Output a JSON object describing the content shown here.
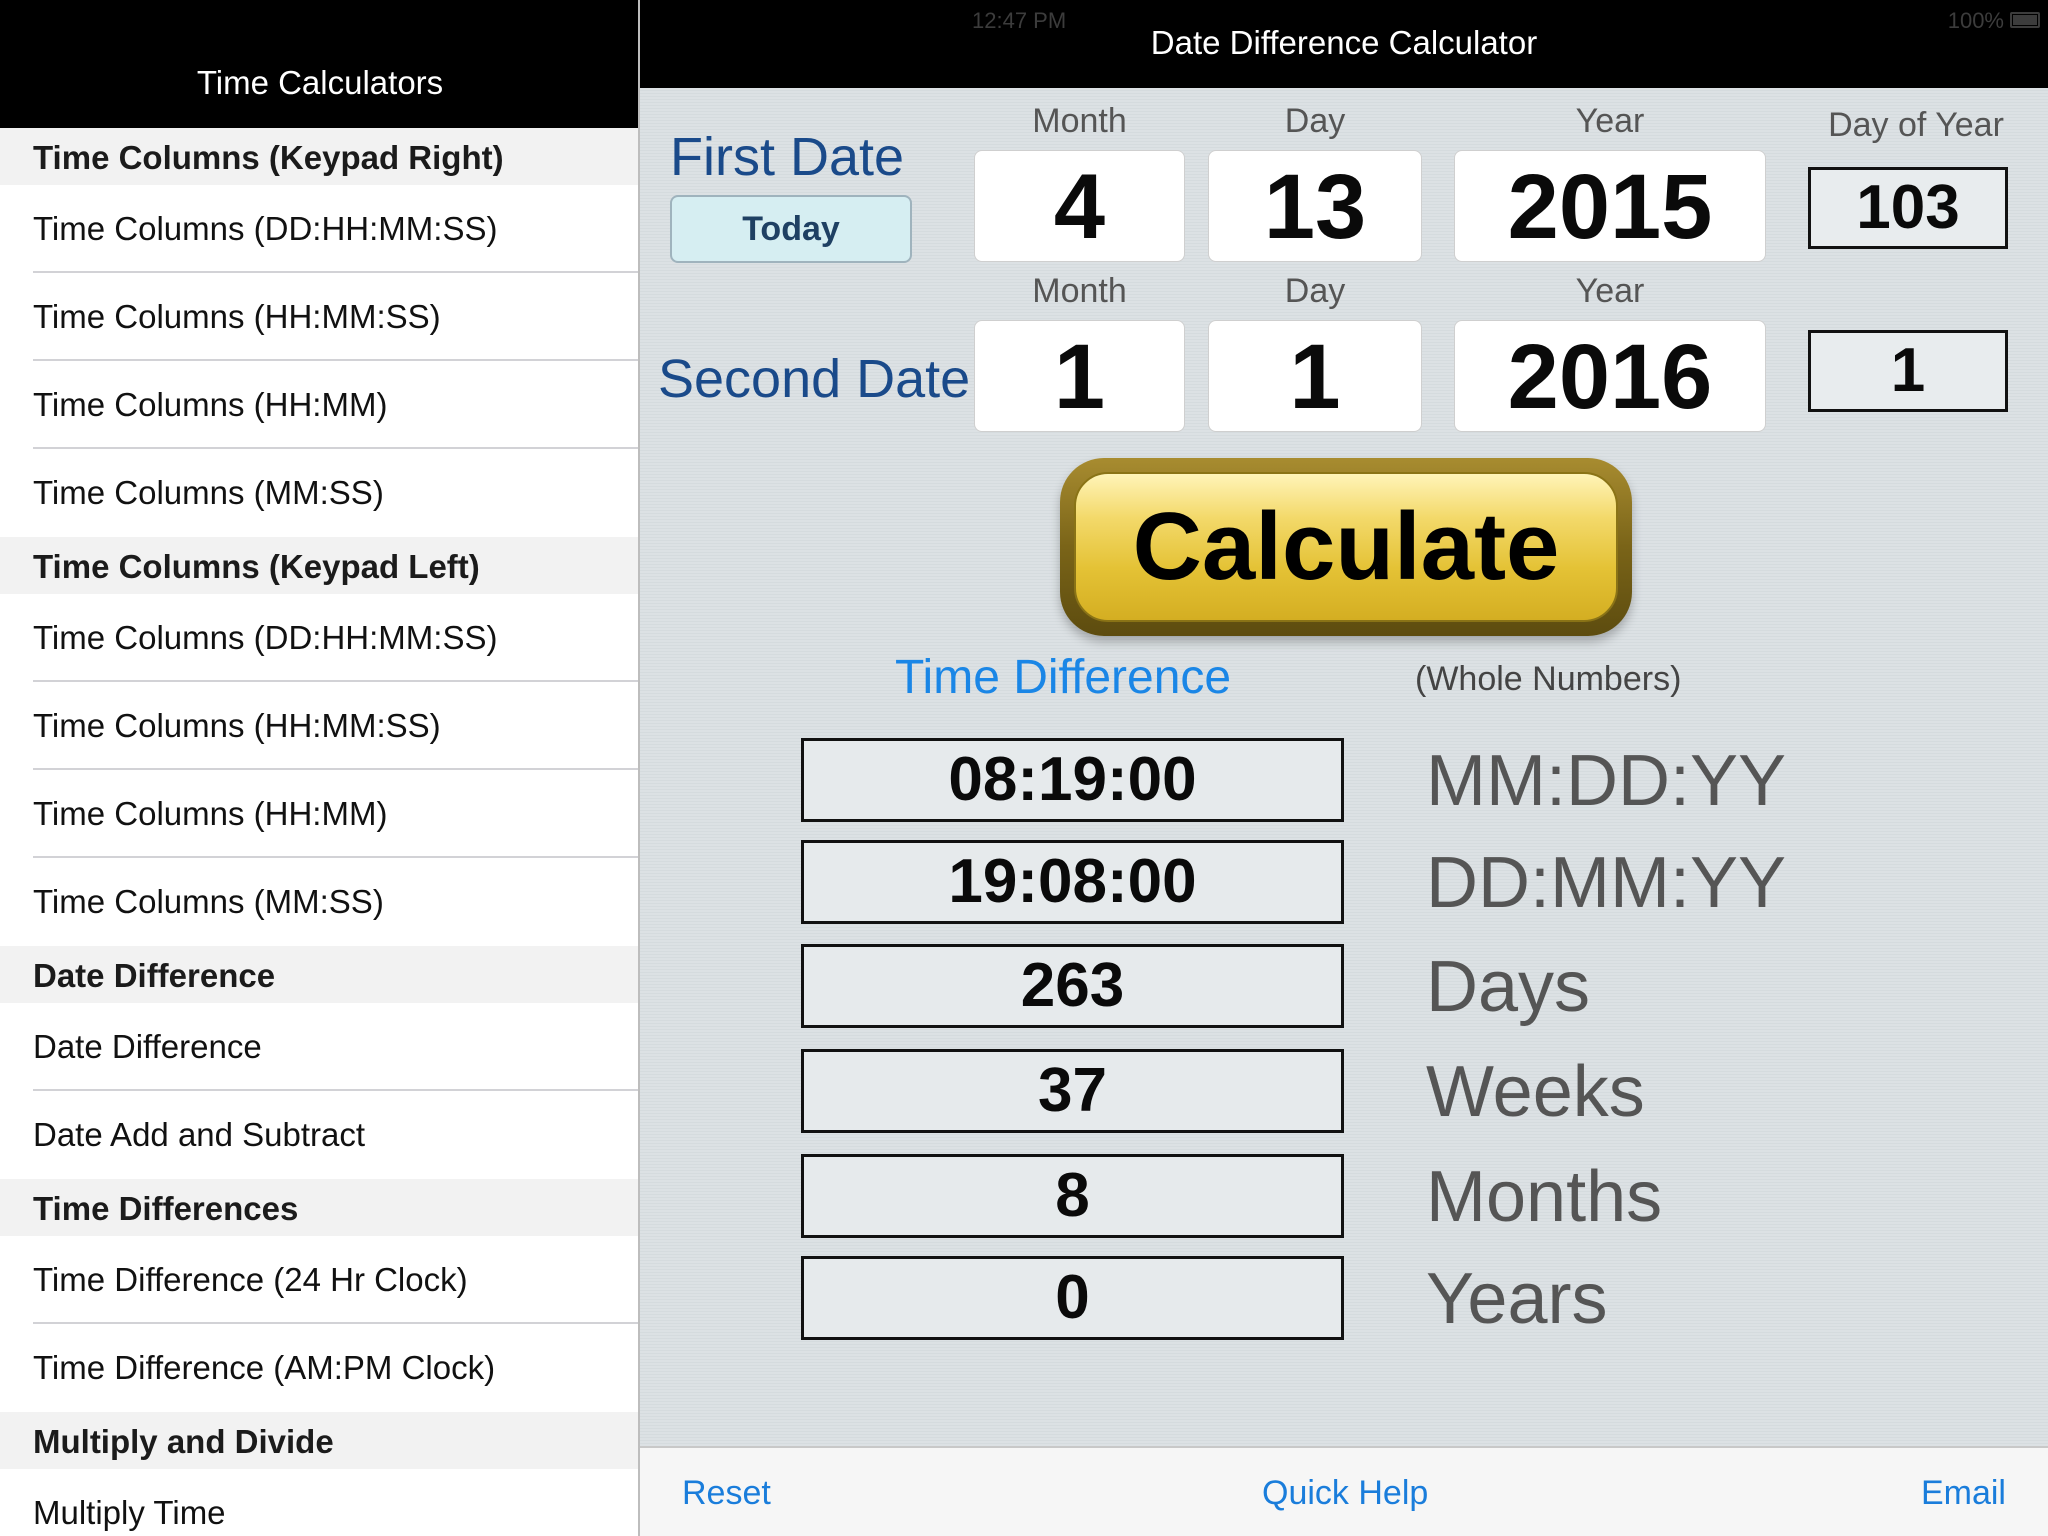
{
  "sidebar": {
    "title": "Time Calculators",
    "sections": [
      {
        "header": "Time Columns (Keypad Right)",
        "items": [
          "Time Columns (DD:HH:MM:SS)",
          "Time Columns (HH:MM:SS)",
          "Time Columns (HH:MM)",
          "Time Columns (MM:SS)"
        ]
      },
      {
        "header": "Time Columns (Keypad Left)",
        "items": [
          "Time Columns (DD:HH:MM:SS)",
          "Time Columns (HH:MM:SS)",
          "Time Columns (HH:MM)",
          "Time Columns (MM:SS)"
        ]
      },
      {
        "header": "Date Difference",
        "items": [
          "Date Difference",
          "Date Add and Subtract"
        ]
      },
      {
        "header": "Time Differences",
        "items": [
          "Time Difference (24 Hr Clock)",
          "Time Difference (AM:PM Clock)"
        ]
      },
      {
        "header": "Multiply and Divide",
        "items": [
          "Multiply Time"
        ]
      }
    ]
  },
  "status": {
    "time": "12:47 PM",
    "battery": "100%"
  },
  "main": {
    "title": "Date Difference Calculator",
    "first_date_label": "First Date",
    "second_date_label": "Second Date",
    "today_label": "Today",
    "col_labels": {
      "month": "Month",
      "day": "Day",
      "year": "Year",
      "day_of_year": "Day of Year"
    },
    "first": {
      "month": "4",
      "day": "13",
      "year": "2015",
      "doy": "103"
    },
    "second": {
      "month": "1",
      "day": "1",
      "year": "2016",
      "doy": "1"
    },
    "calculate_label": "Calculate",
    "time_difference_label": "Time Difference",
    "whole_numbers_label": "(Whole Numbers)",
    "results": [
      {
        "value": "08:19:00",
        "unit": "MM:DD:YY"
      },
      {
        "value": "19:08:00",
        "unit": "DD:MM:YY"
      },
      {
        "value": "263",
        "unit": "Days"
      },
      {
        "value": "37",
        "unit": "Weeks"
      },
      {
        "value": "8",
        "unit": "Months"
      },
      {
        "value": "0",
        "unit": "Years"
      }
    ]
  },
  "toolbar": {
    "reset": "Reset",
    "quick_help": "Quick Help",
    "email": "Email"
  }
}
